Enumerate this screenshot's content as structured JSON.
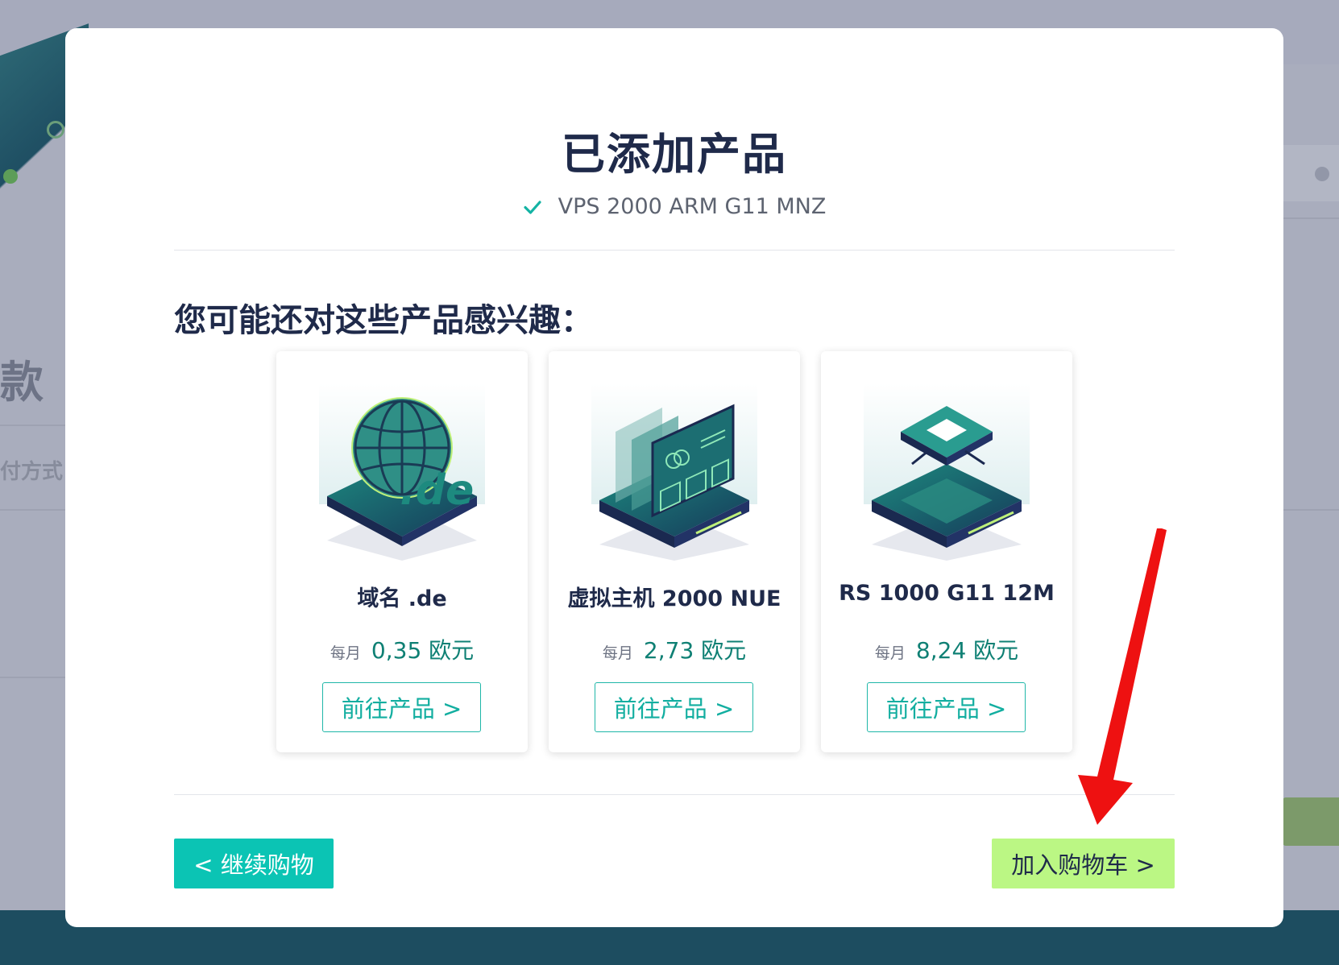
{
  "modal": {
    "title": "已添加产品",
    "added_product": "VPS 2000 ARM G11 MNZ",
    "recommend_title": "您可能还对这些产品感兴趣："
  },
  "products": [
    {
      "name": "域名 .de",
      "period": "每月",
      "price": "0,35 欧元",
      "button": "前往产品 >",
      "image": "domain-globe-icon"
    },
    {
      "name": "虚拟主机 2000 NUE",
      "period": "每月",
      "price": "2,73 欧元",
      "button": "前往产品 >",
      "image": "webhosting-panels-icon"
    },
    {
      "name": "RS 1000 G11 12M",
      "period": "每月",
      "price": "8,24 欧元",
      "button": "前往产品 >",
      "image": "server-chip-icon"
    }
  ],
  "actions": {
    "continue_label": "< 继续购物",
    "cart_label": "加入购物车 >"
  },
  "background": {
    "left_heading_fragment": "款",
    "left_sub_fragment": "付方式"
  },
  "colors": {
    "accent_teal": "#0bc4b4",
    "cart_green": "#bbf784",
    "title_navy": "#1f2a4a",
    "annotation_arrow": "#ee1111"
  }
}
